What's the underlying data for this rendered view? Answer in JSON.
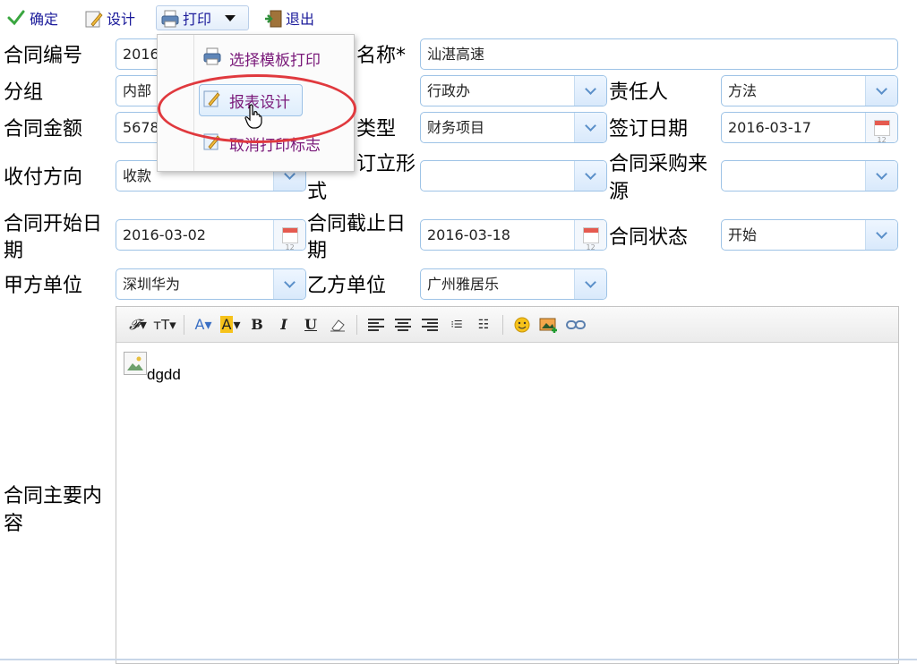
{
  "toolbar": {
    "confirm": "确定",
    "design": "设计",
    "print": "打印",
    "exit": "退出"
  },
  "print_menu": {
    "items": [
      "选择模板打印",
      "报表设计",
      "取消打印标志"
    ],
    "highlighted": "报表设计"
  },
  "form": {
    "contract_no": {
      "label": "合同编号",
      "value": "2016"
    },
    "contract_name": {
      "label": "名称*",
      "value": "汕湛高速"
    },
    "group": {
      "label": "分组",
      "value": "内部"
    },
    "dept": {
      "label": "",
      "value": "行政办"
    },
    "owner": {
      "label": "责任人",
      "value": "方法"
    },
    "amount": {
      "label": "合同金额",
      "value": "5678"
    },
    "type": {
      "label": "类型",
      "value": "财务项目"
    },
    "sign_date": {
      "label": "签订日期",
      "value": "2016-03-17"
    },
    "pay_direction": {
      "label": "收付方向",
      "value": "收款"
    },
    "form_type": {
      "label_line1": "订立形",
      "label_line2": "式",
      "value": ""
    },
    "purchase_source": {
      "label_line1": "合同采购来",
      "label_line2": "源",
      "value": ""
    },
    "start_date": {
      "label_line1": "合同开始日",
      "label_line2": "期",
      "value": "2016-03-02"
    },
    "end_date": {
      "label_line1": "合同截止日",
      "label_line2": "期",
      "value": "2016-03-18"
    },
    "status": {
      "label": "合同状态",
      "value": "开始"
    },
    "party_a": {
      "label": "甲方单位",
      "value": "深圳华为"
    },
    "party_b": {
      "label": "乙方单位",
      "value": "广州雅居乐"
    },
    "content": {
      "label_line1": "合同主要内",
      "label_line2": "容"
    }
  },
  "editor": {
    "toolbar": [
      "font-family",
      "font-size",
      "font-color",
      "highlight",
      "bold",
      "italic",
      "underline",
      "eraser",
      "align-left",
      "align-center",
      "align-right",
      "ordered-list",
      "unordered-list",
      "emoticon",
      "image",
      "link"
    ],
    "body_text": "dgdd",
    "bold": "B",
    "italic": "I",
    "underline": "U",
    "font_glyph": "A"
  },
  "colors": {
    "accent_border": "#9ec3e6",
    "menu_text": "#7a1a7a",
    "highlight_oval": "#e0393e"
  }
}
